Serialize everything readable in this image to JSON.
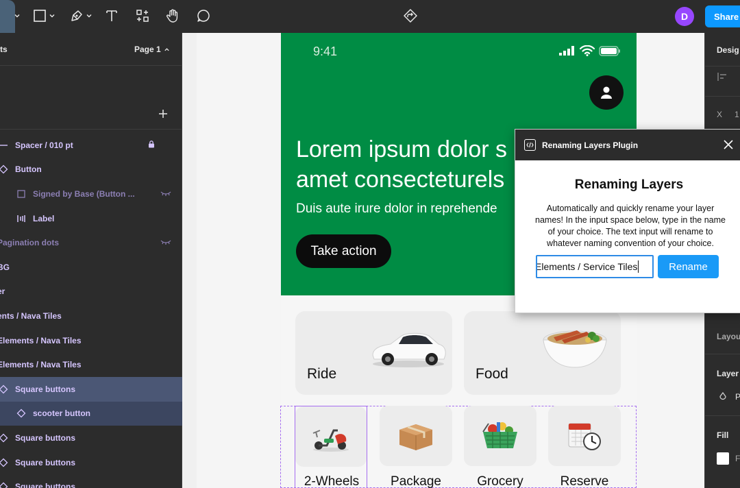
{
  "toolbar": {
    "tools": [
      "move-tool",
      "frame-tool",
      "pen-tool",
      "text-tool",
      "components-tool",
      "hand-tool",
      "comment-tool"
    ],
    "avatar_letter": "D",
    "share_label": "Share"
  },
  "left_panel": {
    "tab_label": "ts",
    "page_label": "Page 1",
    "layers": [
      {
        "label": "Spacer / 010 pt",
        "icon": "spacer-line-icon",
        "indent": 0,
        "right_icon": "lock-icon"
      },
      {
        "label": "Button",
        "icon": "component-icon",
        "indent": 0
      },
      {
        "label": "Signed by Base (Button ...",
        "icon": "frame-square-icon",
        "indent": 1,
        "dim": true,
        "right_icon": "hidden-eye-icon"
      },
      {
        "label": "Label",
        "icon": "auto-layout-icon",
        "indent": 1
      },
      {
        "label": "Pagination dots",
        "icon": "",
        "indent": -1,
        "dim": true,
        "right_icon": "hidden-eye-icon"
      },
      {
        "label": "BG",
        "icon": "",
        "indent": -1
      },
      {
        "label": "er",
        "icon": "",
        "indent": -1
      },
      {
        "label": "ents / Nava Tiles",
        "icon": "",
        "indent": -1
      },
      {
        "label": "Elements / Nava Tiles",
        "icon": "",
        "indent": -1
      },
      {
        "label": "Elements / Nava Tiles",
        "icon": "",
        "indent": -1
      },
      {
        "label": "Square buttons",
        "icon": "component-icon",
        "indent": 0,
        "selected": true
      },
      {
        "label": "scooter button",
        "icon": "component-icon",
        "indent": 1,
        "selected_child": true
      },
      {
        "label": "Square buttons",
        "icon": "component-icon",
        "indent": 0
      },
      {
        "label": "Square buttons",
        "icon": "component-icon",
        "indent": 0
      },
      {
        "label": "Square buttons",
        "icon": "component-icon",
        "indent": 0
      }
    ]
  },
  "phone": {
    "time": "9:41",
    "hero_title": "Lorem ipsum dolor s\namet consecteturels",
    "hero_subtitle": "Duis aute irure dolor in reprehende",
    "cta_label": "Take action",
    "big_tiles": [
      {
        "label": "Ride",
        "art": "car-image"
      },
      {
        "label": "Food",
        "art": "food-bowl-image"
      }
    ],
    "small_tiles": [
      {
        "label": "2-Wheels",
        "art": "scooter-image"
      },
      {
        "label": "Package",
        "art": "package-box-image"
      },
      {
        "label": "Grocery",
        "art": "grocery-basket-image"
      },
      {
        "label": "Reserve",
        "art": "calendar-clock-image"
      }
    ]
  },
  "right_panel": {
    "tab_label": "Desig",
    "x_label": "X",
    "x_value": "1",
    "layout_label": "Layou",
    "layer_label": "Layer",
    "layer_value": "P",
    "fill_label": "Fill",
    "fill_value": "F"
  },
  "plugin": {
    "window_title": "Renaming Layers Plugin",
    "heading": "Renaming Layers",
    "description": "Automatically and quickly rename your layer names! In the input space below, type in the name of your choice. The text input will rename to whatever naming convention of your choice.",
    "input_value": "Elements / Service Tiles",
    "rename_label": "Rename"
  },
  "colors": {
    "hero_green": "#008c44",
    "accent_blue": "#0d99ff",
    "avatar_purple": "#9747ff",
    "selection_purple": "#a56cf0"
  }
}
